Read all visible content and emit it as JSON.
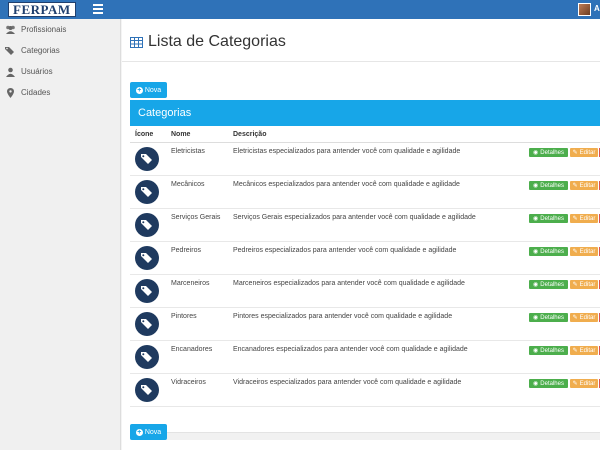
{
  "header": {
    "logo": "FERPAM",
    "user_label": "Ar"
  },
  "sidebar": {
    "items": [
      {
        "label": "Profissionais",
        "icon": "users-icon"
      },
      {
        "label": "Categorias",
        "icon": "tags-icon"
      },
      {
        "label": "Usuários",
        "icon": "user-icon"
      },
      {
        "label": "Cidades",
        "icon": "map-marker-icon"
      }
    ]
  },
  "main": {
    "title": "Lista de Categorias",
    "new_button": "Nova",
    "panel_title": "Categorias",
    "columns": [
      "Ícone",
      "Nome",
      "Descrição"
    ],
    "row_buttons": {
      "details": "Detalhes",
      "edit": "Editar"
    },
    "rows": [
      {
        "nome": "Eletricistas",
        "descricao": "Eletricistas especializados para antender você com qualidade e agilidade"
      },
      {
        "nome": "Mecânicos",
        "descricao": "Mecânicos especializados para antender você com qualidade e agilidade"
      },
      {
        "nome": "Serviços Gerais",
        "descricao": "Serviços Gerais especializados para antender você com qualidade e agilidade"
      },
      {
        "nome": "Pedreiros",
        "descricao": "Pedreiros especializados para antender você com qualidade e agilidade"
      },
      {
        "nome": "Marceneiros",
        "descricao": "Marceneiros especializados para antender você com qualidade e agilidade"
      },
      {
        "nome": "Pintores",
        "descricao": "Pintores especializados para antender você com qualidade e agilidade"
      },
      {
        "nome": "Encanadores",
        "descricao": "Encanadores especializados para antender você com qualidade e agilidade"
      },
      {
        "nome": "Vidraceiros",
        "descricao": "Vidraceiros especializados para antender você com qualidade e agilidade"
      }
    ]
  },
  "colors": {
    "topbar": "#2f72b8",
    "accent": "#17a6e8",
    "details": "#4cae4c",
    "edit": "#f0ad4e",
    "delete": "#d9534f",
    "category_icon_bg": "#1f3a5f"
  }
}
